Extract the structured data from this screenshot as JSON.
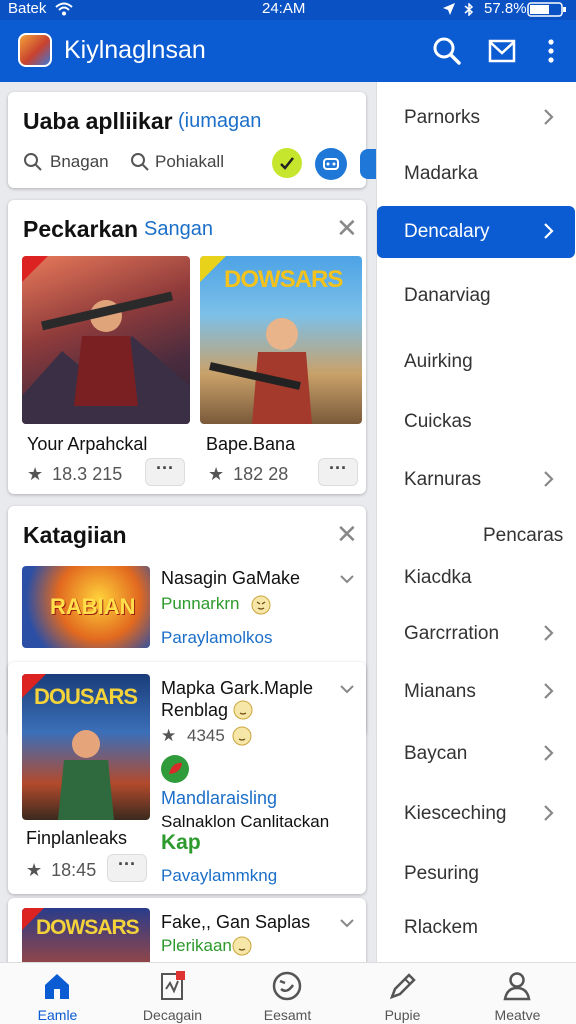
{
  "status_bar": {
    "carrier": "Batek",
    "time": "24:AM",
    "battery": "57.8%"
  },
  "app_bar": {
    "title": "Kiylnaglnsan"
  },
  "search_card": {
    "title": "Uaba aplliikar",
    "subtitle": "(iumagan",
    "chip1": "Bnagan",
    "chip2": "Pohiakall"
  },
  "featured_card": {
    "title": "Peckarkan",
    "subtitle": "Sangan",
    "games": [
      {
        "name": "Your Arpahckal",
        "rating": "18.3 215",
        "thumb_text": ""
      },
      {
        "name": "Bape.Bana",
        "rating": "182 28",
        "thumb_text": "DOWSARS"
      }
    ]
  },
  "category_card": {
    "title": "Katagiian",
    "item1": {
      "title": "Nasagin GaMake",
      "subtitle": "Punnarkrn",
      "link": "Paraylamolkos",
      "thumb_text": "RABIAN"
    }
  },
  "detail_card": {
    "thumb_text": "DOUSARS",
    "title_line1": "Mapka Gark.Maple",
    "title_line2": "Renblag",
    "rating": "4345",
    "developer": "Mandlaraisling",
    "description": "Salnaklon Canlitackan",
    "action": "Kap",
    "name": "Finplanleaks",
    "name_rating": "18:45",
    "link": "Pavaylammkng"
  },
  "last_card": {
    "title": "Fake,, Gan Saplas",
    "subtitle": "Plerikaan",
    "thumb_text": "DOWSARS"
  },
  "sidebar": {
    "items": [
      {
        "label": "Parnorks",
        "chevron": true,
        "active": false
      },
      {
        "label": "Madarka",
        "chevron": false,
        "active": false
      },
      {
        "label": "Dencalary",
        "chevron": true,
        "active": true
      },
      {
        "label": "Danarviag",
        "chevron": false,
        "active": false
      },
      {
        "label": "Auirking",
        "chevron": false,
        "active": false
      },
      {
        "label": "Cuickas",
        "chevron": false,
        "active": false
      },
      {
        "label": "Karnuras",
        "chevron": true,
        "active": false
      },
      {
        "label": "Pencaras",
        "chevron": false,
        "active": false
      },
      {
        "label": "Kiacdka",
        "chevron": false,
        "active": false
      },
      {
        "label": "Garcrration",
        "chevron": true,
        "active": false
      },
      {
        "label": "Mianans",
        "chevron": true,
        "active": false
      },
      {
        "label": "Baycan",
        "chevron": true,
        "active": false
      },
      {
        "label": "Kiesceching",
        "chevron": true,
        "active": false
      },
      {
        "label": "Pesuring",
        "chevron": false,
        "active": false
      },
      {
        "label": "Rlackem",
        "chevron": false,
        "active": false
      }
    ]
  },
  "bottom_nav": {
    "items": [
      {
        "label": "Eamle",
        "icon": "home-icon",
        "active": true
      },
      {
        "label": "Decagain",
        "icon": "document-icon",
        "active": false
      },
      {
        "label": "Eesamt",
        "icon": "smiley-icon",
        "active": false
      },
      {
        "label": "Pupie",
        "icon": "pen-icon",
        "active": false
      },
      {
        "label": "Meatve",
        "icon": "person-icon",
        "active": false
      }
    ]
  },
  "colors": {
    "primary": "#0b5bd3",
    "green": "#2c9a2c",
    "link": "#1c6fc8"
  }
}
